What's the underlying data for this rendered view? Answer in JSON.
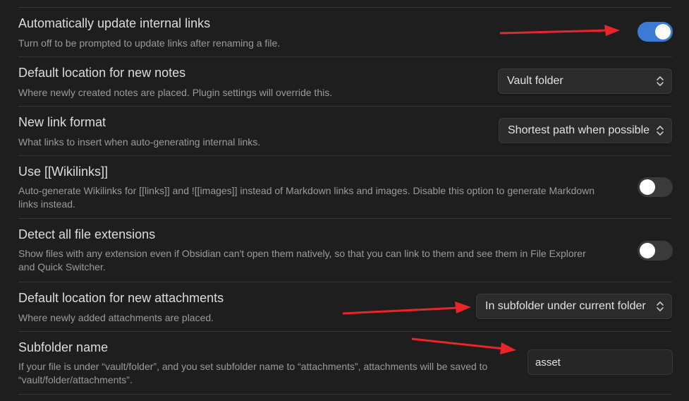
{
  "settings": [
    {
      "name": "Automatically update internal links",
      "description": "Turn off to be prompted to update links after renaming a file.",
      "control": "toggle",
      "toggle_on": true
    },
    {
      "name": "Default location for new notes",
      "description": "Where newly created notes are placed. Plugin settings will override this.",
      "control": "dropdown",
      "selected": "Vault folder"
    },
    {
      "name": "New link format",
      "description": "What links to insert when auto-generating internal links.",
      "control": "dropdown",
      "selected": "Shortest path when possible"
    },
    {
      "name": "Use [[Wikilinks]]",
      "description": "Auto-generate Wikilinks for [[links]] and ![[images]] instead of Markdown links and images. Disable this option to generate Markdown links instead.",
      "control": "toggle",
      "toggle_on": false
    },
    {
      "name": "Detect all file extensions",
      "description": "Show files with any extension even if Obsidian can't open them natively, so that you can link to them and see them in File Explorer and Quick Switcher.",
      "control": "toggle",
      "toggle_on": false
    },
    {
      "name": "Default location for new attachments",
      "description": "Where newly added attachments are placed.",
      "control": "dropdown",
      "selected": "In subfolder under current folder"
    },
    {
      "name": "Subfolder name",
      "description": "If your file is under “vault/folder”, and you set subfolder name to “attachments”, attachments will be saved to “vault/folder/attachments”.",
      "control": "text",
      "value": "asset"
    }
  ],
  "colors": {
    "background": "#1e1e1e",
    "toggle_on": "#3b7bd6",
    "toggle_off": "#3a3a3a",
    "annotation_arrow": "#e8262a"
  },
  "icons": {
    "dropdown": "chevron-up-down-icon",
    "annotation": "red-arrow-annotation"
  }
}
